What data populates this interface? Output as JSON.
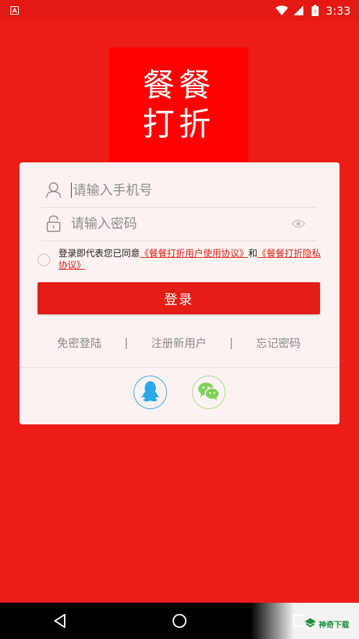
{
  "status_bar": {
    "time": "3:33"
  },
  "logo": {
    "line1": "餐餐",
    "line2": "打折"
  },
  "login": {
    "phone_placeholder": "请输入手机号",
    "password_placeholder": "请输入密码",
    "agree_prefix": "登录即代表您已同意",
    "user_agreement": "《餐餐打折用户使用协议》",
    "and": "和",
    "privacy_agreement": "《餐餐打折隐私协议》",
    "login_button": "登录"
  },
  "links": {
    "quick_login": "免密登陆",
    "sep": "|",
    "register": "注册新用户",
    "forgot": "忘记密码"
  },
  "watermark": {
    "text": "神奇下载"
  },
  "colors": {
    "brand_red": "#ec1c16",
    "qq_blue": "#2ba7ea",
    "wechat_green": "#7ed15a"
  }
}
